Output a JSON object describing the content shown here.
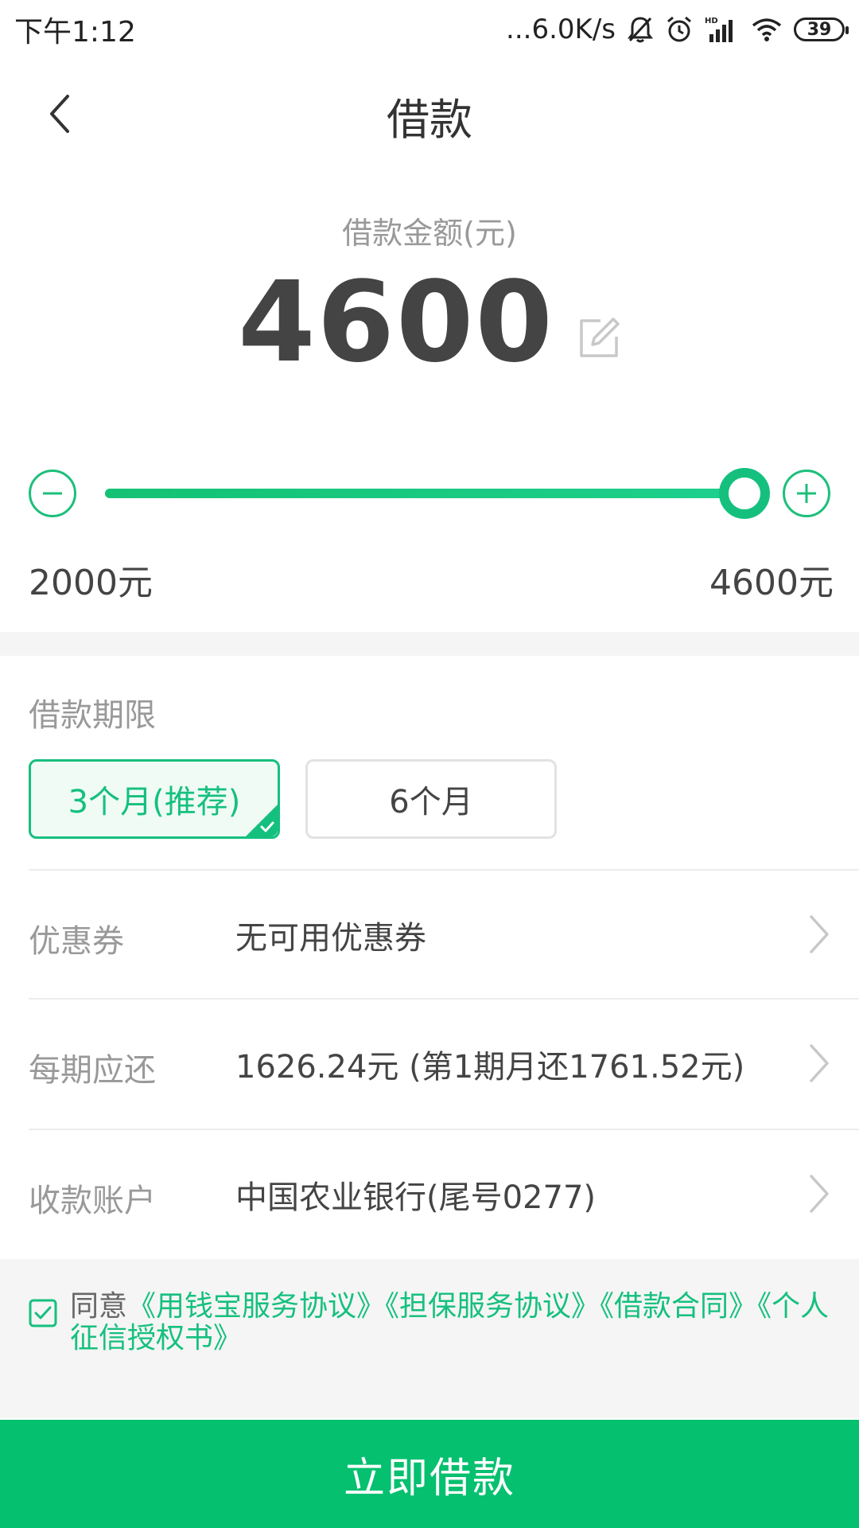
{
  "status_bar": {
    "time": "下午1:12",
    "network_speed": "...6.0K/s",
    "battery_level": "39",
    "hd_label": "HD"
  },
  "header": {
    "title": "借款"
  },
  "amount": {
    "label": "借款金额(元)",
    "value": "4600"
  },
  "slider": {
    "min_label": "2000元",
    "max_label": "4600元",
    "position_fraction": 1.0
  },
  "term": {
    "label": "借款期限",
    "options": [
      {
        "label": "3个月(推荐)",
        "selected": true
      },
      {
        "label": "6个月",
        "selected": false
      }
    ]
  },
  "rows": {
    "coupon": {
      "label": "优惠券",
      "value": "无可用优惠券"
    },
    "repayment": {
      "label": "每期应还",
      "value": "1626.24元 (第1期月还1761.52元)"
    },
    "account": {
      "label": "收款账户",
      "value": "中国农业银行(尾号0277)"
    }
  },
  "agreement": {
    "prefix": "同意",
    "links": [
      "《用钱宝服务协议》",
      "《担保服务协议》",
      "《借款合同》",
      "《个人征信授权书》"
    ],
    "checked": true
  },
  "submit": {
    "label": "立即借款"
  },
  "colors": {
    "accent": "#15c07e",
    "button": "#05c06f",
    "label_gray": "#999999",
    "text_dark": "#444444"
  }
}
